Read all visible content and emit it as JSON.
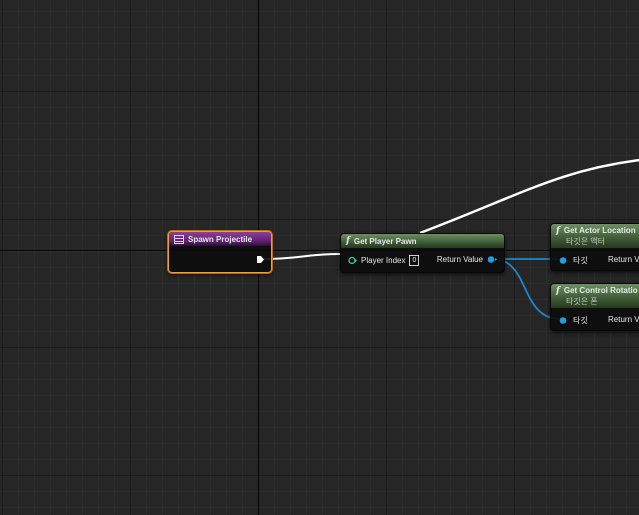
{
  "colors": {
    "grid_bg": "#262626",
    "exec_wire": "#ffffff",
    "object_wire": "#1e88c8",
    "event_header": "#7a2f8c",
    "function_header": "#4b6b40",
    "selection": "#f0a030"
  },
  "nodes": {
    "spawn_projectile": {
      "title": "Spawn Projectile",
      "icon": "event-icon"
    },
    "get_player_pawn": {
      "title": "Get Player Pawn",
      "icon": "function-icon",
      "input_label": "Player Index",
      "input_value": "0",
      "output_label": "Return Value"
    },
    "get_actor_location": {
      "title": "Get Actor Location",
      "subtitle": "타깃은 액터",
      "icon": "function-icon",
      "input_label": "타깃",
      "output_label": "Return V"
    },
    "get_control_rotation": {
      "title": "Get Control Rotatio",
      "subtitle": "타깃은 폰",
      "icon": "function-icon",
      "input_label": "타깃",
      "output_label": "Return V"
    }
  }
}
